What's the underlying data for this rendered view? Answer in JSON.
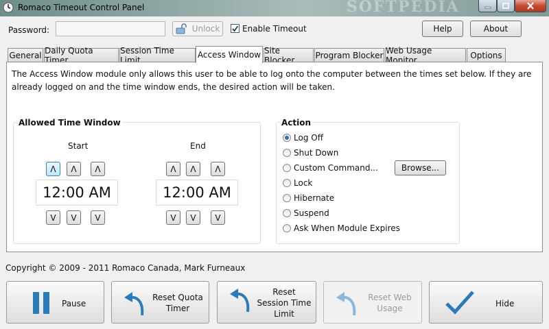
{
  "window": {
    "title": "Romaco Timeout Control Panel",
    "watermark": "SOFTPEDIA"
  },
  "toolbar": {
    "password_label": "Password:",
    "password_value": "",
    "unlock_label": "Unlock",
    "enable_timeout_label": "Enable Timeout",
    "enable_timeout_checked": true,
    "help_label": "Help",
    "about_label": "About"
  },
  "tabs": [
    {
      "label": "General",
      "active": false
    },
    {
      "label": "Daily Quota Timer",
      "active": false
    },
    {
      "label": "Session Time Limit",
      "active": false
    },
    {
      "label": "Access Window",
      "active": true
    },
    {
      "label": "Site Blocker",
      "active": false
    },
    {
      "label": "Program Blocker",
      "active": false
    },
    {
      "label": "Web Usage Monitor",
      "active": false
    },
    {
      "label": "Options",
      "active": false
    }
  ],
  "access_window": {
    "description": "The Access Window module only allows this user to be able to log onto the computer between the times set below. If they are already logged on and the time window ends, the desired action will be taken.",
    "allowed_time_window": {
      "title": "Allowed Time Window",
      "start_label": "Start",
      "start_time": "12:00 AM",
      "end_label": "End",
      "end_time": "12:00 AM",
      "up_glyph": "Λ",
      "down_glyph": "V"
    },
    "action": {
      "title": "Action",
      "options": [
        {
          "label": "Log Off",
          "selected": true
        },
        {
          "label": "Shut Down",
          "selected": false
        },
        {
          "label": "Custom Command...",
          "selected": false
        },
        {
          "label": "Lock",
          "selected": false
        },
        {
          "label": "Hibernate",
          "selected": false
        },
        {
          "label": "Suspend",
          "selected": false
        },
        {
          "label": "Ask When Module Expires",
          "selected": false
        }
      ],
      "browse_label": "Browse..."
    }
  },
  "footer": {
    "copyright": "Copyright © 2009 - 2011 Romaco Canada, Mark Furneaux"
  },
  "bottom_buttons": {
    "pause": "Pause",
    "reset_quota": "Reset Quota Timer",
    "reset_session": "Reset Session Time Limit",
    "reset_web": "Reset Web Usage",
    "hide": "Hide"
  },
  "colors": {
    "accent": "#1d6fa5",
    "icon_blue": "#2b7bb9"
  }
}
